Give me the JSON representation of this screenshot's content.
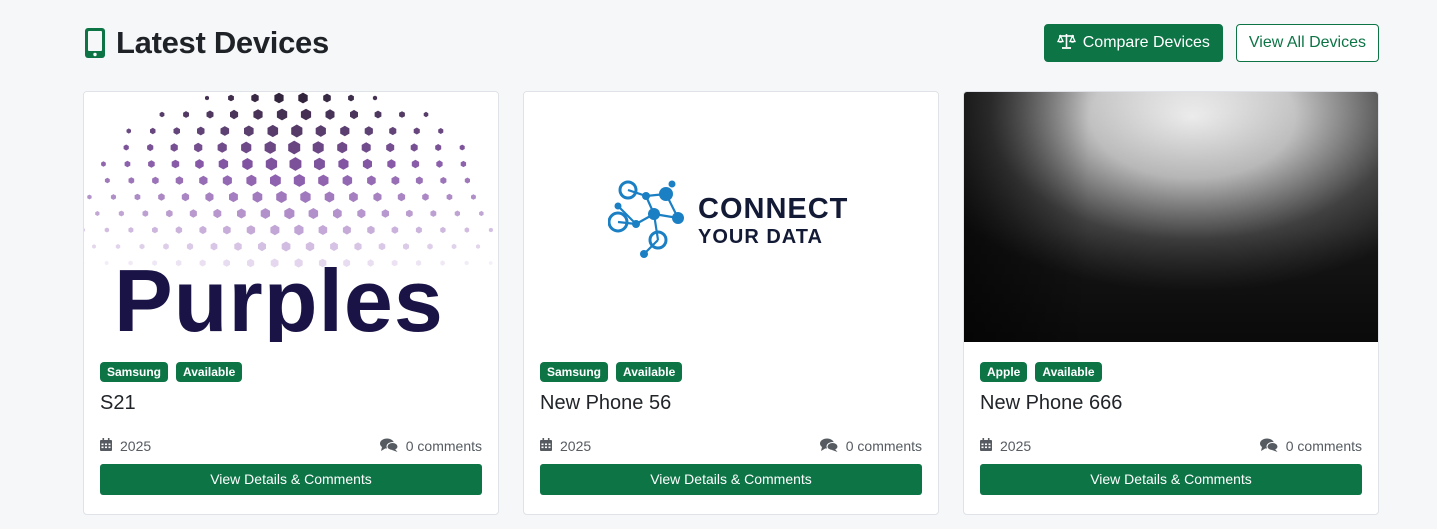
{
  "header": {
    "title": "Latest Devices",
    "compare_label": "Compare Devices",
    "view_all_label": "View All Devices"
  },
  "colors": {
    "accent": "#0d7446",
    "page_bg": "#f6f7f9"
  },
  "cards": [
    {
      "image_text": "Purples",
      "brand": "Samsung",
      "status": "Available",
      "name": "S21",
      "year": "2025",
      "comments": "0 comments",
      "button": "View Details & Comments"
    },
    {
      "image_text_1": "CONNECT",
      "image_text_2": "YOUR DATA",
      "brand": "Samsung",
      "status": "Available",
      "name": "New Phone 56",
      "year": "2025",
      "comments": "0 comments",
      "button": "View Details & Comments"
    },
    {
      "brand": "Apple",
      "status": "Available",
      "name": "New Phone 666",
      "year": "2025",
      "comments": "0 comments",
      "button": "View Details & Comments"
    }
  ]
}
